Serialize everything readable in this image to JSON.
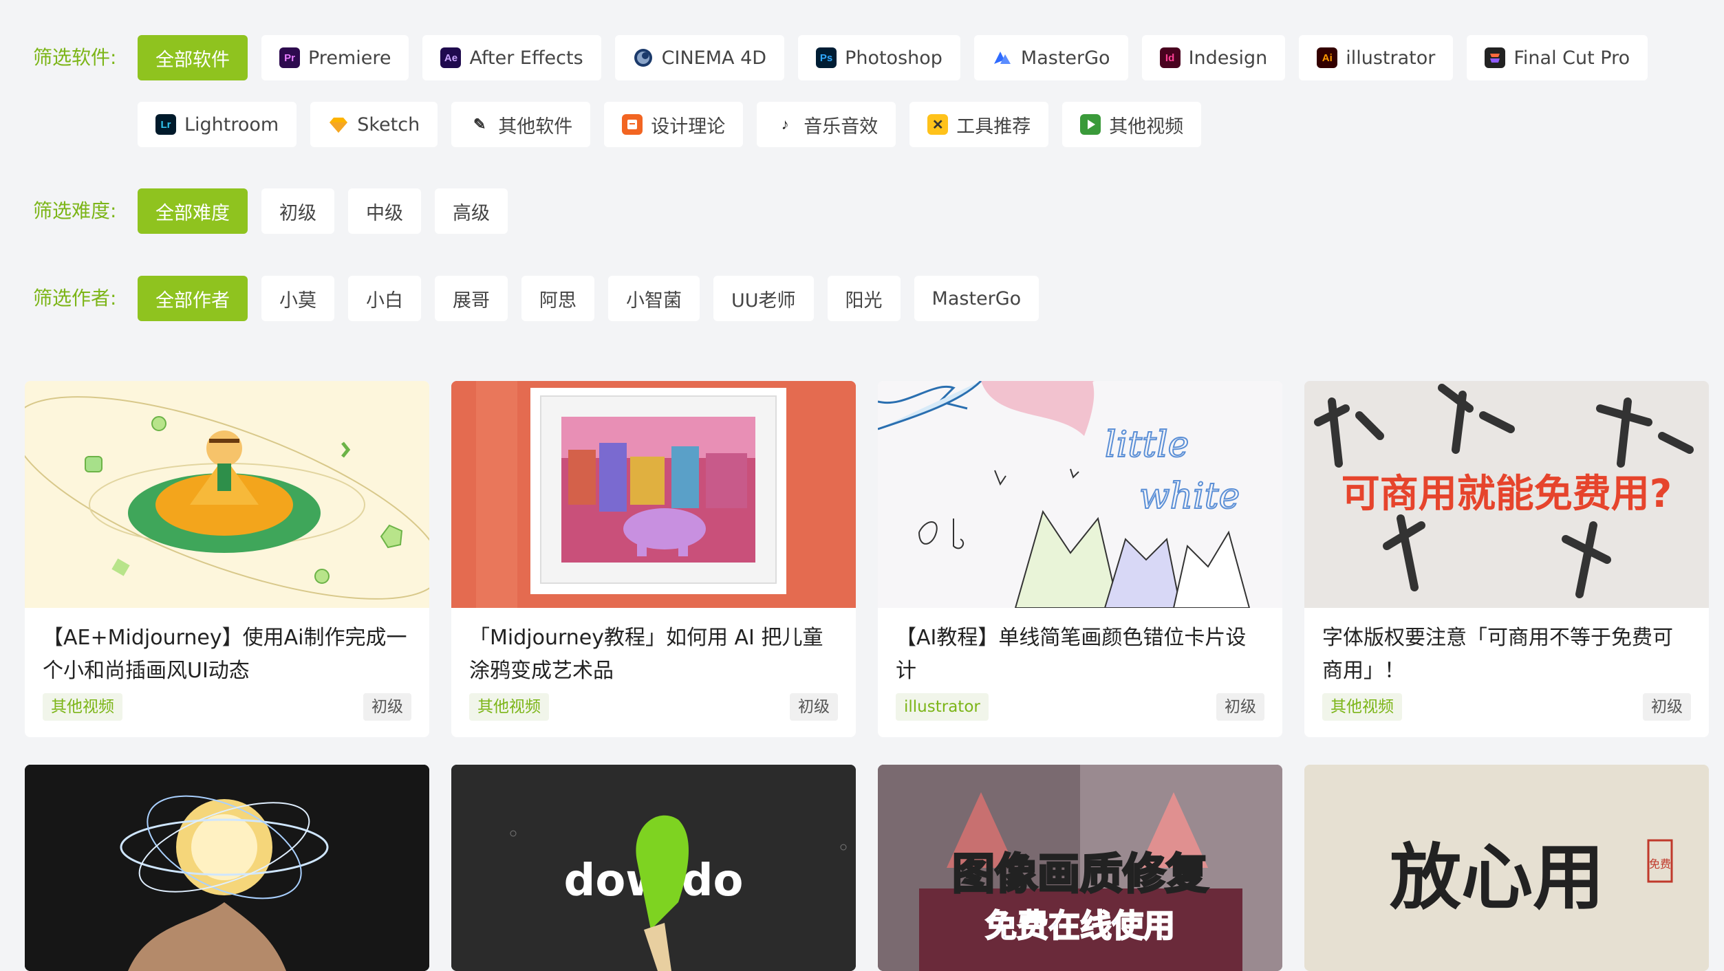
{
  "filters": {
    "software": {
      "label": "筛选软件:",
      "items": [
        {
          "label": "全部软件",
          "icon": "",
          "active": true
        },
        {
          "label": "Premiere",
          "icon": "premiere-icon"
        },
        {
          "label": "After Effects",
          "icon": "after-effects-icon"
        },
        {
          "label": "CINEMA 4D",
          "icon": "cinema4d-icon"
        },
        {
          "label": "Photoshop",
          "icon": "photoshop-icon"
        },
        {
          "label": "MasterGo",
          "icon": "mastergo-icon"
        },
        {
          "label": "Indesign",
          "icon": "indesign-icon"
        },
        {
          "label": "illustrator",
          "icon": "illustrator-icon"
        },
        {
          "label": "Final Cut Pro",
          "icon": "final-cut-pro-icon"
        },
        {
          "label": "Lightroom",
          "icon": "lightroom-icon"
        },
        {
          "label": "Sketch",
          "icon": "sketch-icon"
        },
        {
          "label": "其他软件",
          "icon": "other-software-icon"
        },
        {
          "label": "设计理论",
          "icon": "design-theory-icon"
        },
        {
          "label": "音乐音效",
          "icon": "music-note-icon"
        },
        {
          "label": "工具推荐",
          "icon": "tools-icon"
        },
        {
          "label": "其他视频",
          "icon": "play-video-icon"
        }
      ],
      "icon_text": {
        "premiere": "Pr",
        "after_effects": "Ae",
        "photoshop": "Ps",
        "indesign": "Id",
        "illustrator": "Ai",
        "lightroom": "Lr"
      }
    },
    "difficulty": {
      "label": "筛选难度:",
      "items": [
        "全部难度",
        "初级",
        "中级",
        "高级"
      ]
    },
    "author": {
      "label": "筛选作者:",
      "items": [
        "全部作者",
        "小莫",
        "小白",
        "展哥",
        "阿思",
        "小智菌",
        "UU老师",
        "阳光",
        "MasterGo"
      ]
    }
  },
  "colors": {
    "accent": "#8fc31f",
    "label_green": "#7cb518"
  },
  "cards": [
    {
      "title": "【AE+Midjourney】使用Ai制作完成一个小和尚插画风UI动态",
      "category": "其他视频",
      "level": "初级"
    },
    {
      "title": "「Midjourney教程」如何用 AI 把儿童涂鸦变成艺术品",
      "category": "其他视频",
      "level": "初级"
    },
    {
      "title": "【AI教程】单线简笔画颜色错位卡片设计",
      "category": "illustrator",
      "level": "初级"
    },
    {
      "title": "字体版权要注意「可商用不等于免费可商用」！",
      "category": "其他视频",
      "level": "初级"
    }
  ],
  "thumb_text": {
    "card3_little": "little",
    "card3_white": "white",
    "card4_overlay": "可商用就能免费用?",
    "row2_card2": "dow   do",
    "row2_card3_main": "图像画质修复",
    "row2_card3_sub": "免费在线使用",
    "row2_card4": "放心用",
    "row2_card4_seal": "免费"
  }
}
